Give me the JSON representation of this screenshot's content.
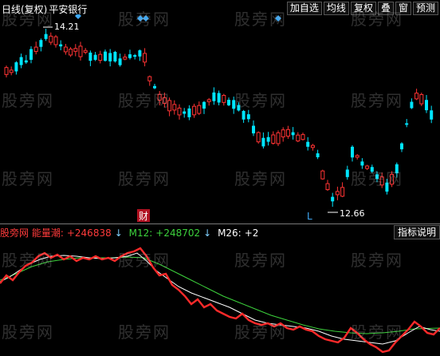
{
  "header": {
    "period_label": "日线(复权)",
    "stock_name": "平安银行"
  },
  "toolbar": {
    "buttons": [
      "加自选",
      "均线",
      "复权",
      "叠",
      "窗",
      "预测"
    ]
  },
  "main_chart": {
    "high_label": "14.21",
    "low_label": "12.66",
    "low_marker": "L",
    "finance_marker": "财",
    "colors": {
      "up": "#ff3333",
      "down": "#00e5ff",
      "diamond": "#3fa9f5",
      "background": "#000000"
    }
  },
  "indicator": {
    "name": "股旁网 能量潮:",
    "value": "+246838",
    "m12_label": "M12:",
    "m12_value": "+248702",
    "m26_label": "M26:",
    "m26_value": "+2",
    "arrow": "↓",
    "settings_button": "指标说明",
    "colors": {
      "obv": "#ff2a2a",
      "m12": "#3cd23c",
      "m26": "#ffffff"
    }
  },
  "watermark": "股旁网"
}
